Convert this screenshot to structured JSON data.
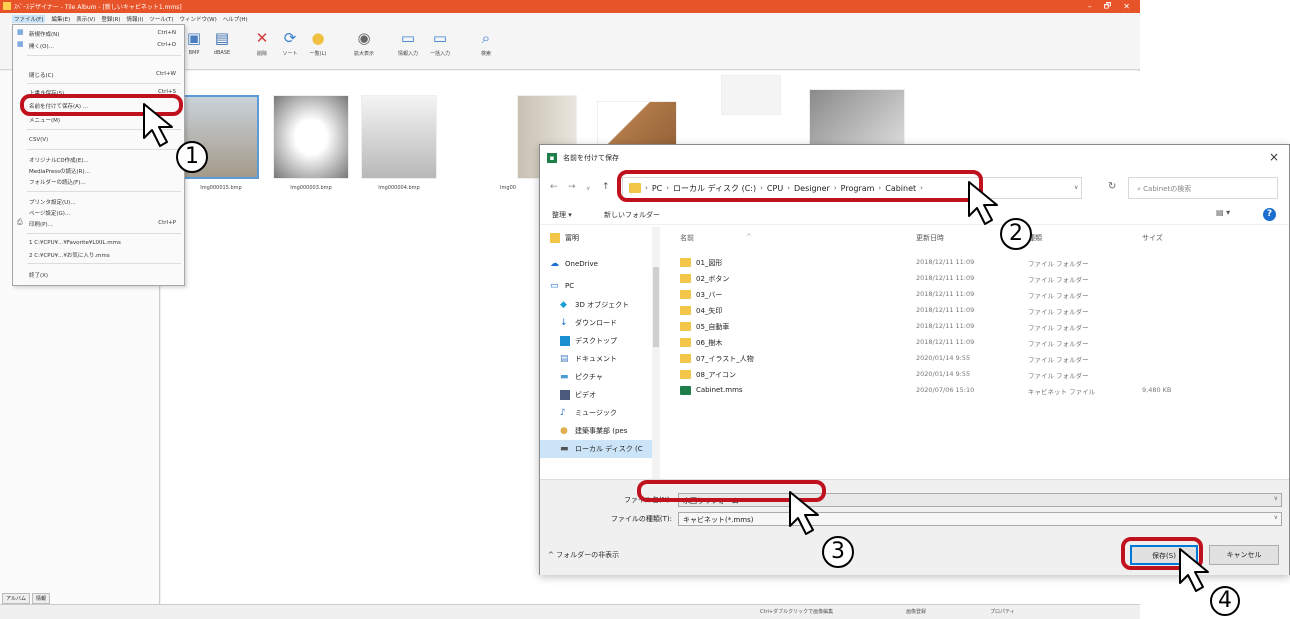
{
  "app": {
    "title": "ｽﾍﾟｰｽデザイナー - Tile Album - [新しいキャビネット1.mms]",
    "window_buttons": [
      "–",
      "🗗",
      "✕"
    ],
    "menus": [
      "ファイル(F)",
      "編集(E)",
      "表示(V)",
      "登録(R)",
      "情報(I)",
      "ツール(T)",
      "ウィンドウ(W)",
      "ヘルプ(H)"
    ],
    "toolbar": [
      "BMP",
      "dBASE",
      "削除",
      "ソート",
      "一覧(L)",
      "拡大表示",
      "情報入力",
      "一括入力",
      "検索"
    ],
    "thumbnails": [
      "Img000015.bmp",
      "Img000003.bmp",
      "Img000004.bmp",
      "Img00"
    ],
    "left_tabs": [
      "アルバム",
      "情報"
    ],
    "status": [
      "Ctrl+ダブルクリックで画像編集",
      "画像登録",
      "プロパティ"
    ]
  },
  "file_menu": {
    "items": [
      {
        "label": "新規作成(N)",
        "shortcut": "Ctrl+N"
      },
      {
        "label": "開く(O)...",
        "shortcut": "Ctrl+O"
      },
      {
        "label": "閉じる(C)",
        "shortcut": "Ctrl+W"
      },
      {
        "label": "上書き保存(S)",
        "shortcut": "Ctrl+S"
      },
      {
        "label": "名前を付けて保存(A) ...",
        "shortcut": ""
      },
      {
        "label": "メニュー(M)",
        "shortcut": ""
      },
      {
        "label": "CSV(V)",
        "shortcut": ""
      },
      {
        "label": "オリジナルCD作成(E)...",
        "shortcut": ""
      },
      {
        "label": "MediaPressの読込(R)...",
        "shortcut": ""
      },
      {
        "label": "フォルダーの読込(F)...",
        "shortcut": ""
      },
      {
        "label": "プリンタ設定(U)...",
        "shortcut": ""
      },
      {
        "label": "ページ設定(G)...",
        "shortcut": ""
      },
      {
        "label": "印刷(P)...",
        "shortcut": "Ctrl+P"
      },
      {
        "label": "1 C:¥CPU¥...¥Favorite¥LIXIL.mms",
        "shortcut": ""
      },
      {
        "label": "2 C:¥CPU¥...¥お気に入り.mms",
        "shortcut": ""
      },
      {
        "label": "終了(X)",
        "shortcut": ""
      }
    ]
  },
  "dialog": {
    "title": "名前を付けて保存",
    "close": "×",
    "breadcrumb": [
      "PC",
      "ローカル ディスク (C:)",
      "CPU",
      "Designer",
      "Program",
      "Cabinet"
    ],
    "search_placeholder": "Cabinetの検索",
    "organize": "整理 ▾",
    "new_folder": "新しいフォルダー",
    "nav_items": [
      {
        "label": "冨明",
        "icon": "folder-icon"
      },
      {
        "label": "OneDrive",
        "icon": "cloud-icon"
      },
      {
        "label": "PC",
        "icon": "pc-icon"
      },
      {
        "label": "3D オブジェクト",
        "icon": "cube-icon"
      },
      {
        "label": "ダウンロード",
        "icon": "download-icon"
      },
      {
        "label": "デスクトップ",
        "icon": "desktop-icon"
      },
      {
        "label": "ドキュメント",
        "icon": "document-icon"
      },
      {
        "label": "ピクチャ",
        "icon": "picture-icon"
      },
      {
        "label": "ビデオ",
        "icon": "video-icon"
      },
      {
        "label": "ミュージック",
        "icon": "music-icon"
      },
      {
        "label": "建築事業部 (pes",
        "icon": "user-icon"
      },
      {
        "label": "ローカル ディスク (C",
        "icon": "drive-icon"
      }
    ],
    "columns": {
      "name": "名前",
      "date": "更新日時",
      "type": "種類",
      "size": "サイズ"
    },
    "files": [
      {
        "name": "01_図形",
        "date": "2018/12/11 11:09",
        "type": "ファイル フォルダー",
        "size": ""
      },
      {
        "name": "02_ボタン",
        "date": "2018/12/11 11:09",
        "type": "ファイル フォルダー",
        "size": ""
      },
      {
        "name": "03_バー",
        "date": "2018/12/11 11:09",
        "type": "ファイル フォルダー",
        "size": ""
      },
      {
        "name": "04_矢印",
        "date": "2018/12/11 11:09",
        "type": "ファイル フォルダー",
        "size": ""
      },
      {
        "name": "05_自動車",
        "date": "2018/12/11 11:09",
        "type": "ファイル フォルダー",
        "size": ""
      },
      {
        "name": "06_樹木",
        "date": "2018/12/11 11:09",
        "type": "ファイル フォルダー",
        "size": ""
      },
      {
        "name": "07_イラスト_人物",
        "date": "2020/01/14 9:55",
        "type": "ファイル フォルダー",
        "size": ""
      },
      {
        "name": "08_アイコン",
        "date": "2020/01/14 9:55",
        "type": "ファイル フォルダー",
        "size": ""
      },
      {
        "name": "Cabinet.mms",
        "date": "2020/07/06 15:10",
        "type": "キャビネット ファイル",
        "size": "9,480 KB"
      }
    ],
    "filename_label": "ファイル名(N):",
    "filename_value": "水回りリフォーム",
    "filetype_label": "ファイルの種類(T):",
    "filetype_value": "キャビネット(*.mms)",
    "hide_folders": "フォルダーの非表示",
    "save_button": "保存(S)",
    "cancel_button": "キャンセル"
  },
  "callouts": [
    "1",
    "2",
    "3",
    "4"
  ],
  "colors": {
    "highlight": "#c0111e",
    "titlebar": "#e8542a",
    "accent": "#0078d7",
    "folder": "#f3c64a"
  }
}
